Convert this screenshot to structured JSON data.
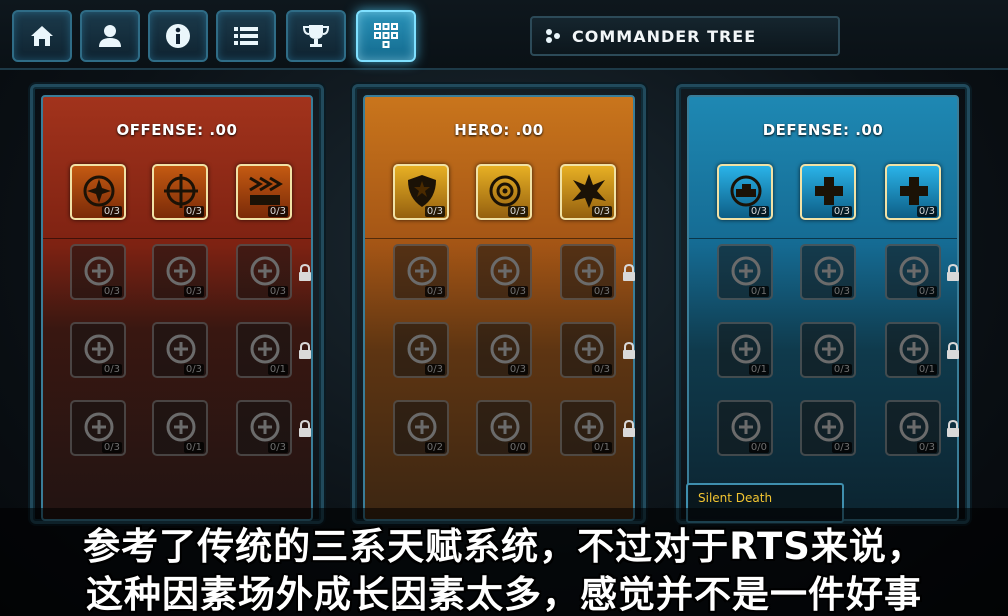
{
  "nav": [
    {
      "id": "home",
      "icon": "home-icon"
    },
    {
      "id": "profile",
      "icon": "person-icon"
    },
    {
      "id": "info",
      "icon": "info-icon"
    },
    {
      "id": "list",
      "icon": "list-icon"
    },
    {
      "id": "achievements",
      "icon": "trophy-icon"
    },
    {
      "id": "commander-tree",
      "icon": "tree-icon",
      "active": true
    }
  ],
  "title": "COMMANDER TREE",
  "panels": {
    "offense": {
      "title": "OFFENSE: .00",
      "rows": [
        [
          "0/3",
          "0/3",
          "0/3"
        ],
        [
          "0/3",
          "0/3",
          "0/3"
        ],
        [
          "0/3",
          "0/3",
          "0/1"
        ],
        [
          "0/3",
          "0/1",
          "0/3"
        ]
      ]
    },
    "hero": {
      "title": "HERO: .00",
      "rows": [
        [
          "0/3",
          "0/3",
          "0/3"
        ],
        [
          "0/3",
          "0/3",
          "0/3"
        ],
        [
          "0/3",
          "0/3",
          "0/3"
        ],
        [
          "0/2",
          "0/0",
          "0/1"
        ]
      ]
    },
    "defense": {
      "title": "DEFENSE: .00",
      "rows": [
        [
          "0/3",
          "0/3",
          "0/3"
        ],
        [
          "0/1",
          "0/3",
          "0/3"
        ],
        [
          "0/1",
          "0/3",
          "0/1"
        ],
        [
          "0/0",
          "0/3",
          "0/3"
        ]
      ]
    }
  },
  "tooltip": {
    "title": "Silent Death"
  },
  "caption": {
    "line1": "参考了传统的三系天赋系统，不过对于RTS来说，",
    "line2": "这种因素场外成长因素太多，感觉并不是一件好事"
  },
  "colors": {
    "offense": "#a2331c",
    "hero": "#c9751c",
    "defense": "#1e88b3",
    "highlight": "#7fe0ff",
    "tooltip_title": "#f2c531"
  }
}
